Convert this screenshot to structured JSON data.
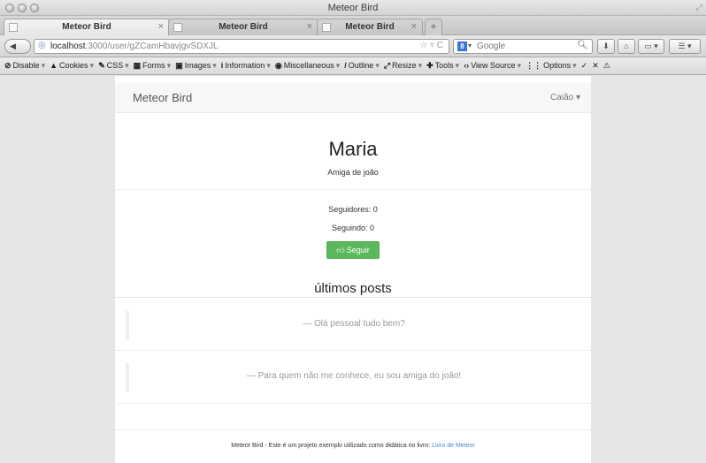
{
  "window": {
    "title": "Meteor Bird"
  },
  "tabs": [
    {
      "label": "Meteor Bird",
      "active": true
    },
    {
      "label": "Meteor Bird",
      "active": false
    },
    {
      "label": "Meteor Bird",
      "active": false
    }
  ],
  "nav": {
    "url_host": "localhost",
    "url_path": ":3000/user/gZCamHbavjgvSDXJL",
    "search_engine": "Google",
    "search_badge": "8"
  },
  "webdev_toolbar": [
    {
      "icon": "⊘",
      "label": "Disable",
      "icon_name": "disable-icon"
    },
    {
      "icon": "▲",
      "label": "Cookies",
      "icon_name": "cookies-icon"
    },
    {
      "icon": "✎",
      "label": "CSS",
      "icon_name": "css-icon"
    },
    {
      "icon": "▦",
      "label": "Forms",
      "icon_name": "forms-icon"
    },
    {
      "icon": "▣",
      "label": "Images",
      "icon_name": "images-icon"
    },
    {
      "icon": "i",
      "label": "Information",
      "icon_name": "information-icon"
    },
    {
      "icon": "◉",
      "label": "Miscellaneous",
      "icon_name": "miscellaneous-icon"
    },
    {
      "icon": "/",
      "label": "Outline",
      "icon_name": "outline-icon"
    },
    {
      "icon": "⤢",
      "label": "Resize",
      "icon_name": "resize-icon"
    },
    {
      "icon": "✚",
      "label": "Tools",
      "icon_name": "tools-icon"
    },
    {
      "icon": "‹›",
      "label": "View Source",
      "icon_name": "view-source-icon"
    },
    {
      "icon": "⋮⋮",
      "label": "Options",
      "icon_name": "options-icon"
    }
  ],
  "site": {
    "brand": "Meteor Bird",
    "user_menu": "Caião ▾"
  },
  "profile": {
    "name": "Maria",
    "bio": "Amiga de joão",
    "followers": "Seguidores: 0",
    "following": "Seguindo: 0",
    "follow_button": "Seguir"
  },
  "posts": {
    "title": "últimos posts",
    "items": [
      "— Olá pessoal tudo bem?",
      "— Para quem não me conhece, eu sou amiga do joão!"
    ]
  },
  "footer": {
    "text": "Meteor Bird - Este é um projeto exemplo utilizado como didática no livro: ",
    "link": "Livro de Meteor"
  },
  "colors": {
    "follow_button": "#5cb85c",
    "footer_link": "#428bca"
  }
}
